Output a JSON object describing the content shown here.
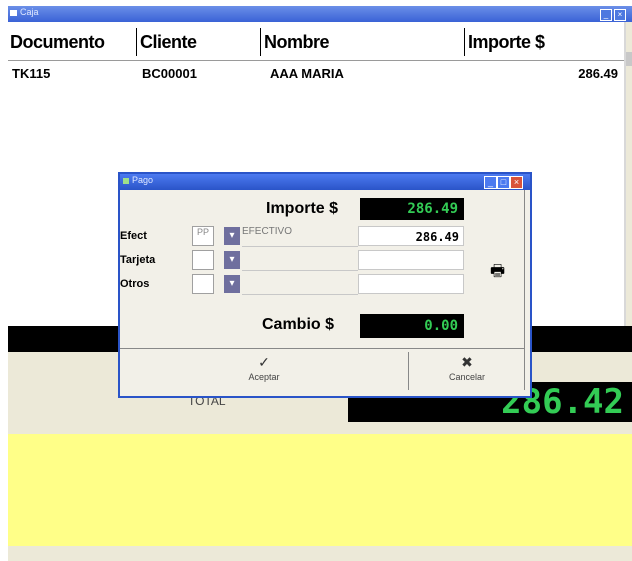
{
  "window": {
    "title": "Caja"
  },
  "grid": {
    "headers": [
      "Documento",
      "Cliente",
      "Nombre",
      "Importe $"
    ],
    "row": {
      "documento": "TK115",
      "cliente": "BC00001",
      "nombre": "AAA MARIA",
      "importe": "286.49"
    }
  },
  "total_display": "286.42",
  "faint_label": "TOTAL",
  "dialog": {
    "title": "Pago",
    "importe_label": "Importe $",
    "importe_value": "286.49",
    "cambio_label": "Cambio $",
    "cambio_value": "0.00",
    "rows": [
      {
        "label": "Efect",
        "code": "PP",
        "desc": "EFECTIVO",
        "amount": "286.49"
      },
      {
        "label": "Tarjeta",
        "code": "",
        "desc": "",
        "amount": ""
      },
      {
        "label": "Otros",
        "code": "",
        "desc": "",
        "amount": ""
      }
    ],
    "accept_label": "Aceptar",
    "cancel_label": "Cancelar"
  }
}
